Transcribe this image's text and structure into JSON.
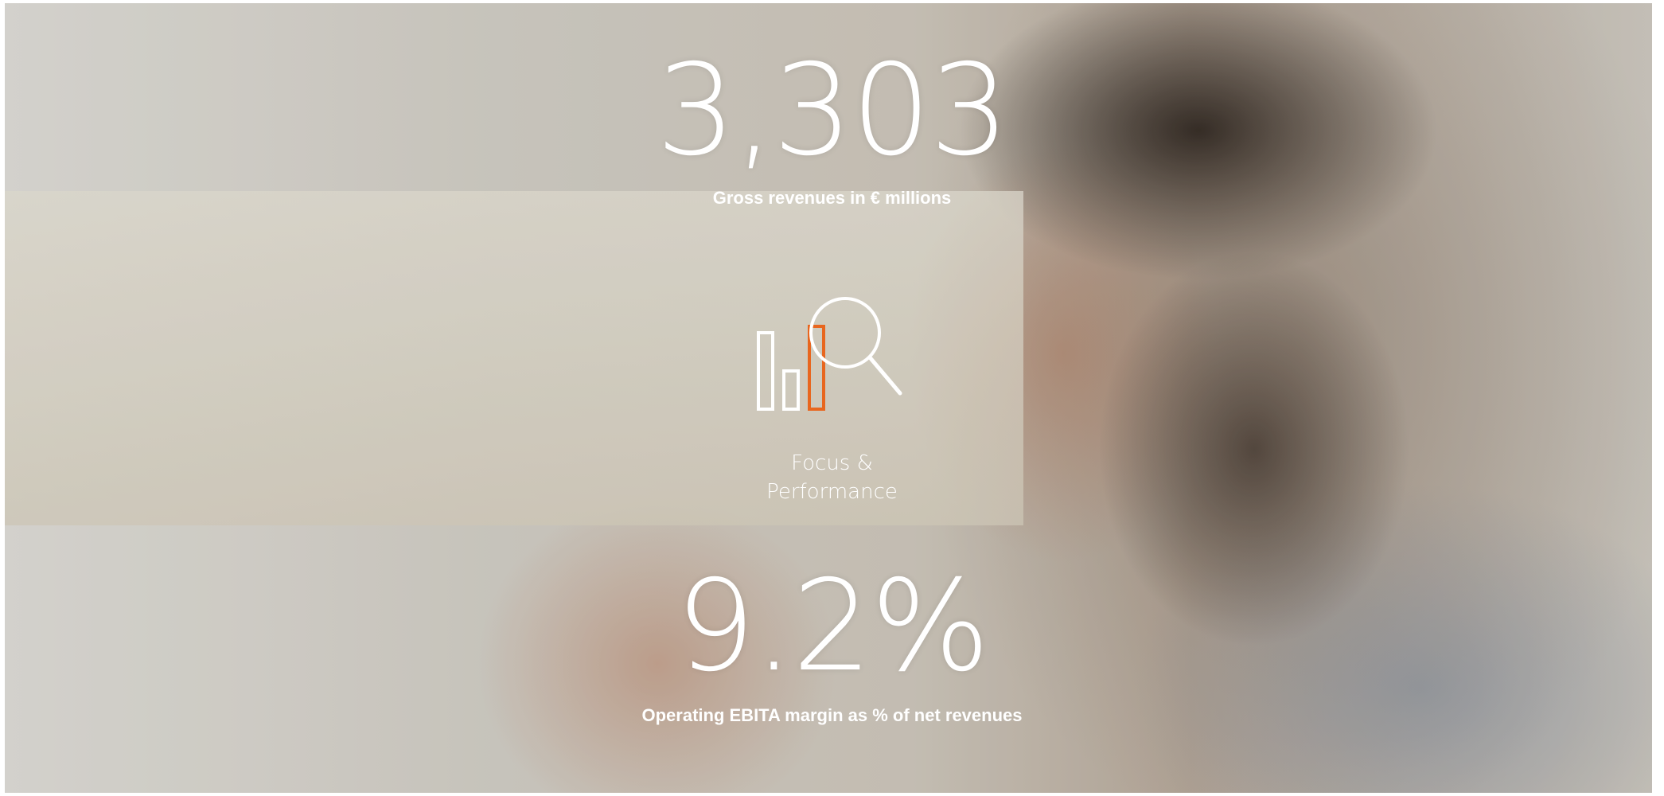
{
  "stats": {
    "revenue": {
      "value": "3,303",
      "caption": "Gross revenues in € millions"
    },
    "margin": {
      "value": "9.2%",
      "caption": "Operating EBITA margin as % of net revenues"
    }
  },
  "theme": {
    "label_line1": "Focus &",
    "label_line2": "Performance",
    "icon": "bar-chart-magnifier-icon"
  },
  "colors": {
    "text": "#ffffff",
    "accent": "#e8661e"
  }
}
